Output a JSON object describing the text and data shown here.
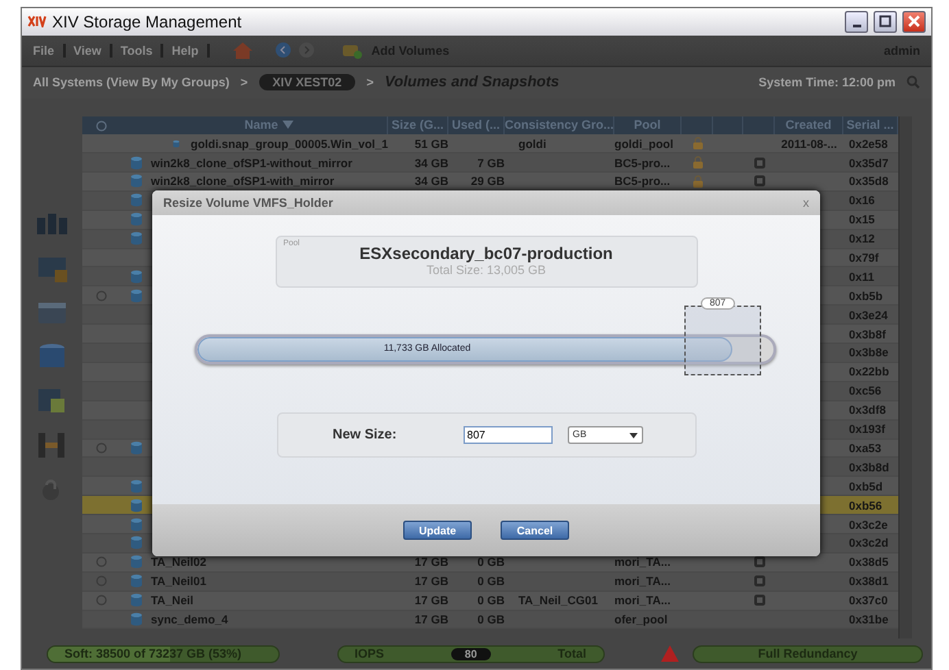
{
  "window": {
    "title": "XIV Storage Management"
  },
  "menu": [
    {
      "label": "File"
    },
    {
      "label": "View"
    },
    {
      "label": "Tools"
    },
    {
      "label": "Help"
    }
  ],
  "toolbar": {
    "add_volumes": "Add Volumes",
    "user": "admin"
  },
  "breadcrumb": {
    "root": "All Systems (View By My Groups)",
    "separator_1": ">",
    "system": "XIV XEST02",
    "separator_2": ">",
    "page": "Volumes and Snapshots",
    "system_time": "System Time: 12:00 pm"
  },
  "table": {
    "columns": [
      {
        "label": "Name",
        "sorted": true
      },
      {
        "label": "Size (G...",
        "sorted": false
      },
      {
        "label": "Used (...",
        "sorted": false
      },
      {
        "label": "Consistency Gro...",
        "sorted": false
      },
      {
        "label": "Pool",
        "sorted": false
      },
      {
        "kind": "icon"
      },
      {
        "kind": "icon"
      },
      {
        "kind": "icon"
      },
      {
        "label": "Created",
        "sorted": false
      },
      {
        "label": "Serial ...",
        "sorted": false
      }
    ],
    "rows": [
      {
        "kind": "snapshot",
        "icon": true,
        "expander": false,
        "name": "goldi.snap_group_00005.Win_vol_1",
        "size": "51 GB",
        "used": "",
        "cg": "goldi",
        "pool": "goldi_pool",
        "locked": true,
        "mirror_icon": false,
        "created": "2011-08-...",
        "serial": "0x2e58",
        "selected": false
      },
      {
        "kind": "volume",
        "icon": true,
        "expander": false,
        "name": "win2k8_clone_ofSP1-without_mirror",
        "size": "34 GB",
        "used": "7 GB",
        "cg": "",
        "pool": "BC5-pro...",
        "locked": true,
        "mirror_icon": true,
        "created": "",
        "serial": "0x35d7",
        "selected": false
      },
      {
        "kind": "volume",
        "icon": true,
        "expander": false,
        "name": "win2k8_clone_ofSP1-with_mirror",
        "size": "34 GB",
        "used": "29 GB",
        "cg": "",
        "pool": "BC5-pro...",
        "locked": true,
        "mirror_icon": true,
        "created": "",
        "serial": "0x35d8",
        "selected": false
      },
      {
        "kind": "volume",
        "icon": true,
        "expander": false,
        "serial": "0x16",
        "selected": false
      },
      {
        "kind": "volume",
        "icon": true,
        "expander": false,
        "serial": "0x15",
        "selected": false
      },
      {
        "kind": "volume",
        "icon": true,
        "expander": false,
        "serial": "0x12",
        "selected": false
      },
      {
        "kind": "volume",
        "icon": false,
        "expander": false,
        "serial": "0x79f",
        "selected": false
      },
      {
        "kind": "volume",
        "icon": true,
        "expander": false,
        "serial": "0x11",
        "selected": false
      },
      {
        "kind": "volume",
        "icon": true,
        "expander": true,
        "serial": "0xb5b",
        "selected": false
      },
      {
        "kind": "volume",
        "icon": false,
        "expander": false,
        "serial": "0x3e24",
        "selected": false
      },
      {
        "kind": "volume",
        "icon": false,
        "expander": false,
        "serial": "0x3b8f",
        "selected": false
      },
      {
        "kind": "volume",
        "icon": false,
        "expander": false,
        "serial": "0x3b8e",
        "selected": false
      },
      {
        "kind": "volume",
        "icon": false,
        "expander": false,
        "serial": "0x22bb",
        "selected": false
      },
      {
        "kind": "volume",
        "icon": false,
        "expander": false,
        "serial": "0xc56",
        "selected": false
      },
      {
        "kind": "volume",
        "icon": false,
        "expander": false,
        "serial": "0x3df8",
        "selected": false
      },
      {
        "kind": "volume",
        "icon": false,
        "expander": false,
        "serial": "0x193f",
        "selected": false
      },
      {
        "kind": "volume",
        "icon": true,
        "expander": true,
        "serial": "0xa53",
        "selected": false
      },
      {
        "kind": "volume",
        "icon": false,
        "expander": false,
        "serial": "0x3b8d",
        "selected": false
      },
      {
        "kind": "volume",
        "icon": true,
        "expander": false,
        "serial": "0xb5d",
        "selected": false
      },
      {
        "kind": "volume",
        "icon": true,
        "expander": false,
        "serial": "0xb56",
        "selected": true
      },
      {
        "kind": "volume",
        "icon": true,
        "expander": false,
        "serial": "0x3c2e",
        "selected": false
      },
      {
        "kind": "volume",
        "icon": true,
        "expander": false,
        "serial": "0x3c2d",
        "selected": false
      },
      {
        "kind": "volume",
        "icon": true,
        "expander": true,
        "name": "TA_Neil02",
        "size": "17 GB",
        "used": "0 GB",
        "cg": "",
        "pool": "mori_TA...",
        "locked": false,
        "mirror_icon": true,
        "created": "",
        "serial": "0x38d5",
        "selected": false
      },
      {
        "kind": "volume",
        "icon": true,
        "expander": true,
        "name": "TA_Neil01",
        "size": "17 GB",
        "used": "0 GB",
        "cg": "",
        "pool": "mori_TA...",
        "locked": false,
        "mirror_icon": true,
        "created": "",
        "serial": "0x38d1",
        "selected": false
      },
      {
        "kind": "volume",
        "icon": true,
        "expander": true,
        "name": "TA_Neil",
        "size": "17 GB",
        "used": "0 GB",
        "cg": "TA_Neil_CG01",
        "pool": "mori_TA...",
        "locked": false,
        "mirror_icon": true,
        "created": "",
        "serial": "0x37c0",
        "selected": false
      },
      {
        "kind": "volume",
        "icon": true,
        "expander": false,
        "name": "sync_demo_4",
        "size": "17 GB",
        "used": "0 GB",
        "cg": "",
        "pool": "ofer_pool",
        "locked": false,
        "mirror_icon": false,
        "created": "",
        "serial": "0x31be",
        "selected": false
      }
    ]
  },
  "dialog": {
    "title": "Resize Volume VMFS_Holder",
    "close": "x",
    "pool_label": "Pool",
    "pool_name": "ESXsecondary_bc07-production",
    "total_size": "Total Size: 13,005 GB",
    "allocated": "11,733 GB Allocated",
    "level": 0.93,
    "handle_value": "807",
    "new_size_label": "New Size:",
    "new_size_value": "807",
    "unit": "GB",
    "buttons": [
      "Update",
      "Cancel"
    ]
  },
  "status_bar": {
    "capacity": "Soft: 38500 of 73237 GB (53%)",
    "level": 0.53,
    "iops_label": "IOPS",
    "iops_value": "80",
    "iops_scope": "Total",
    "redundancy": "Full Redundancy"
  }
}
